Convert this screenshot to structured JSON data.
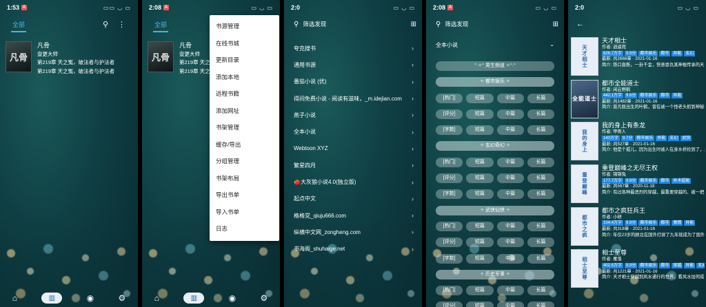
{
  "p1": {
    "time": "1:53",
    "net": "",
    "tab": "全部",
    "book": {
      "cover": "凡骨",
      "title": "凡骨",
      "author": "壹更大师",
      "line1": "第219章 天之冤，破法者与护法者",
      "line2": "第219章 天之冤，破法者与护法者"
    }
  },
  "p2": {
    "time": "2:08",
    "tab": "全部",
    "book": {
      "cover": "凡骨",
      "title": "凡骨",
      "author": "壹更大师",
      "line1": "第219章 天之冤",
      "line2": "第219章 天之冤"
    },
    "menu": [
      "书源管理",
      "在线书城",
      "更新目录",
      "添加本地",
      "远程书籍",
      "添加网址",
      "书架管理",
      "缓存/导出",
      "分组管理",
      "书架布局",
      "导出书单",
      "导入书单",
      "日志"
    ]
  },
  "p3": {
    "time": "2:0",
    "search": "筛选发现",
    "sources": [
      "夸克搜书",
      "通用书源",
      "番茄小说 (优)",
      "得间免费小说 - 阅读有滋味，_m.idejian.com",
      "燕子小说",
      "全本小说",
      "Webtoon XYZ",
      "繁星四月",
      "🍅大灰狼小说4.0(独立版)",
      "起点中文",
      "格格党_qiuju666.com",
      "纵横中文网_zongheng.com",
      "书海阁_shuhaige.net"
    ]
  },
  "p4": {
    "time": "2:08",
    "search": "筛选发现",
    "head": "全本小说",
    "rows": [
      [
        "°·✧° 男生频道 ✧°·°"
      ],
      [
        "✧ 都市娱乐 ✧"
      ],
      [
        "[热门]",
        "短篇",
        "中篇",
        "长篇"
      ],
      [
        "[评分]",
        "短篇",
        "中篇",
        "长篇"
      ],
      [
        "[字数]",
        "短篇",
        "中篇",
        "长篇"
      ],
      [
        "✧ 玄幻奇幻 ✧"
      ],
      [
        "[热门]",
        "短篇",
        "中篇",
        "长篇"
      ],
      [
        "[评分]",
        "短篇",
        "中篇",
        "长篇"
      ],
      [
        "[字数]",
        "短篇",
        "中篇",
        "长篇"
      ],
      [
        "✧ 武侠仙侠 ✧"
      ],
      [
        "[热门]",
        "短篇",
        "中篇",
        "长篇"
      ],
      [
        "[评分]",
        "短篇",
        "中篇",
        "长篇"
      ],
      [
        "[字数]",
        "短篇",
        "中篇",
        "长篇"
      ],
      [
        "✧ 历史军事 ✧"
      ],
      [
        "[热门]",
        "短篇",
        "中篇",
        "长篇"
      ],
      [
        "[评分]",
        "短篇",
        "中篇",
        "长篇"
      ]
    ]
  },
  "p5": {
    "time": "2:0",
    "title": "",
    "subtitle": "",
    "books": [
      {
        "cover": "天才相士",
        "title": "天才相士",
        "author": "作者: 逍遥兜",
        "tags": [
          "826.7万字",
          "9.9分",
          "都市娱乐",
          "都市",
          "异能",
          "玄幻"
        ],
        "latest": "最新: 共2666章 · 2021-01-16",
        "intro": "简介: 铁口直断，一卦千金，快意恩仇某神棍传承的天才相士，在都市行走时是相当吓人的……"
      },
      {
        "cover": "全能道士",
        "pic": true,
        "title": "都市全能道士",
        "author": "作者: 闲云野鹤",
        "tags": [
          "442.1万字",
          "9.6分",
          "都市娱乐",
          "都市",
          "异能"
        ],
        "latest": "最新: 共1482章 · 2021-01-16",
        "intro": "简介: 普凡既出生的叶鹤，曾在被一个怪老头抓到神秘的荒岛上，既可以测算天机，都也学到了神秘本……"
      },
      {
        "cover": "我的身上",
        "title": "我的身上有条龙",
        "author": "作者: 甲骨人",
        "tags": [
          "140万字",
          "9.7分",
          "都市娱乐",
          "异能",
          "玄幻",
          "武侠"
        ],
        "latest": "最新: 共527章 · 2021-01-16",
        "intro": "简介: 他是个孤儿，因为出生时被人在身水桥捡到了，所以叫秦他，\"秦\"是秦始皇的秦，即让他踏居……"
      },
      {
        "cover": "重登巅峰",
        "title": "重登巅峰之无尽王权",
        "author": "作者: 锦锦兔",
        "tags": [
          "177.7万字",
          "9.9分",
          "都市娱乐",
          "都市",
          "异术超能"
        ],
        "latest": "最新: 共567章 · 2020-11-18",
        "intro": "简介: 有过各种最恶烈的穿越，最重要穿越的、被一把刀送过去的，被万丈高楼砸过去的，被深……"
      },
      {
        "cover": "都市之疯",
        "title": "都市之疯狂兵王",
        "author": "作者: 小研",
        "tags": [
          "104.4万字",
          "9.9分",
          "都市娱乐",
          "都市",
          "激情",
          "异能"
        ],
        "latest": "最新: 共318章 · 2021-01-16",
        "intro": "简介: 年仅23岁的顾北在国外打拼了九年就成为了国外第一豪霸，国国那接到同学的电话，要请他……"
      },
      {
        "cover": "相士至尊",
        "title": "相士至尊",
        "author": "作者: 雁落",
        "tags": [
          "402.5万字",
          "9.9分",
          "都市娱乐",
          "都市",
          "穿越",
          "异能",
          "玄幻"
        ],
        "latest": "最新: 共1221章 · 2021-01-16",
        "intro": "简介: 天才相士穿越到风水通行的世界，看风水加何成为亲方世界的至尊，看相士如何走上至尊之……"
      }
    ]
  }
}
